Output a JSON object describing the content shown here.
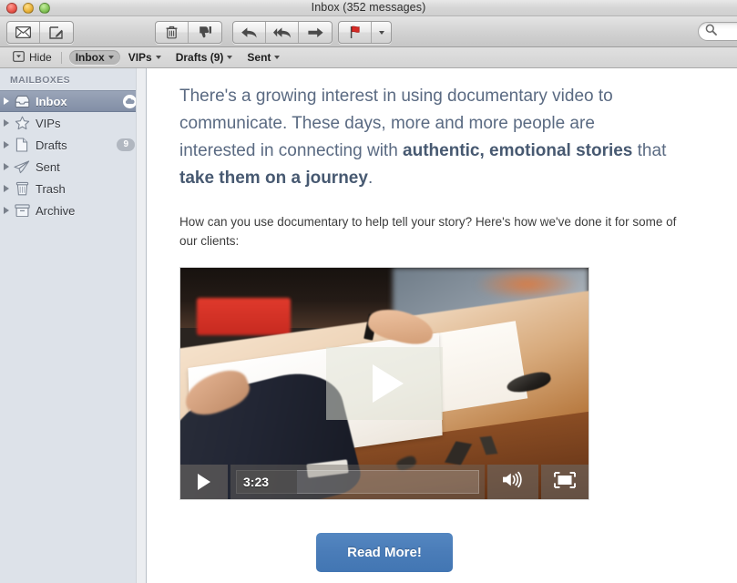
{
  "window": {
    "title": "Inbox (352 messages)",
    "traffic_lights": [
      "close",
      "minimize",
      "zoom"
    ]
  },
  "toolbar": {
    "buttons": [
      {
        "name": "get-mail-button",
        "icon": "envelope-icon",
        "label": "Get Mail"
      },
      {
        "name": "compose-button",
        "icon": "compose-pencil-icon",
        "label": "New Message"
      },
      {
        "name": "delete-button",
        "icon": "trash-icon",
        "label": "Delete"
      },
      {
        "name": "junk-button",
        "icon": "thumbs-down-icon",
        "label": "Junk"
      },
      {
        "name": "reply-button",
        "icon": "reply-arrow-icon",
        "label": "Reply"
      },
      {
        "name": "reply-all-button",
        "icon": "reply-all-arrow-icon",
        "label": "Reply All"
      },
      {
        "name": "forward-button",
        "icon": "forward-arrow-icon",
        "label": "Forward"
      },
      {
        "name": "flag-button",
        "icon": "red-flag-icon",
        "label": "Flag"
      },
      {
        "name": "flag-menu-button",
        "icon": "chevron-down-icon",
        "label": "Flag Options"
      }
    ],
    "search": {
      "placeholder": "",
      "value": "",
      "icon": "search-icon"
    }
  },
  "favorites_bar": {
    "hide_label": "Hide",
    "hide_icon": "sidebar-toggle-icon",
    "items": [
      {
        "label": "Inbox",
        "active": true
      },
      {
        "label": "VIPs",
        "active": false
      },
      {
        "label": "Drafts (9)",
        "active": false
      },
      {
        "label": "Sent",
        "active": false
      }
    ]
  },
  "sidebar": {
    "section_title": "MAILBOXES",
    "items": [
      {
        "label": "Inbox",
        "icon": "inbox-tray-icon",
        "selected": true,
        "badge": "",
        "cloud": true
      },
      {
        "label": "VIPs",
        "icon": "star-icon",
        "selected": false,
        "badge": "",
        "cloud": false
      },
      {
        "label": "Drafts",
        "icon": "draft-page-icon",
        "selected": false,
        "badge": "9",
        "cloud": false
      },
      {
        "label": "Sent",
        "icon": "paper-plane-icon",
        "selected": false,
        "badge": "",
        "cloud": false
      },
      {
        "label": "Trash",
        "icon": "trash-can-icon",
        "selected": false,
        "badge": "",
        "cloud": false
      },
      {
        "label": "Archive",
        "icon": "archive-box-icon",
        "selected": false,
        "badge": "",
        "cloud": false
      }
    ]
  },
  "message": {
    "lede_part1": "There's a growing interest in using documentary video to communicate. These days, more and more people are interested in connecting with ",
    "lede_bold1": "authentic, emotional stories",
    "lede_part2": " that ",
    "lede_bold2": "take them on a journey",
    "lede_part3": ".",
    "paragraph": "How can you use documentary to help tell your story? Here's how we've done it for some of our clients:",
    "video": {
      "duration": "3:23",
      "play_icon": "play-triangle-icon",
      "overlay_play_icon": "play-overlay-icon",
      "volume_icon": "speaker-volume-icon",
      "fullscreen_icon": "fullscreen-icon"
    },
    "cta_label": "Read More!"
  },
  "colors": {
    "cta_blue": "#4a7cb8",
    "lede_text": "#5a6a82",
    "sidebar_bg": "#dde2e9",
    "selection_blue": "#828fa6",
    "flag_red": "#d62b26"
  }
}
